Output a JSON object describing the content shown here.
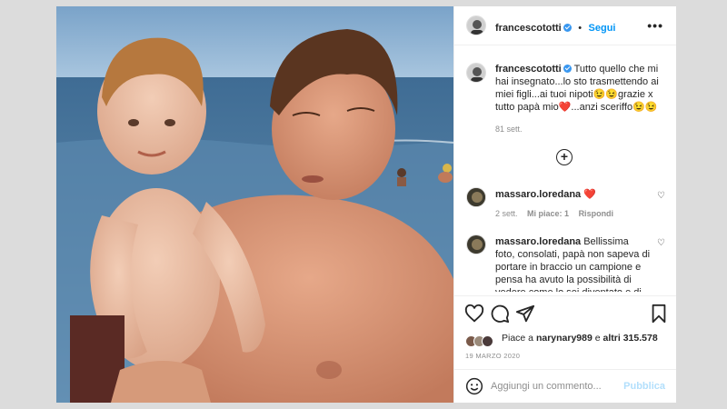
{
  "post": {
    "username": "francescototti",
    "follow_label": "Segui",
    "more_label": "•••",
    "caption": "Tutto quello che mi hai insegnato...lo sto trasmettendo ai miei figli...ai tuoi nipoti😉😉grazie x tutto papà mio❤️...anzi sceriffo😉😉",
    "caption_age": "81 sett.",
    "load_more_label": "+"
  },
  "comments": [
    {
      "username": "massaro.loredana",
      "text": "❤️",
      "age": "2 sett.",
      "likes": "Mi piace: 1",
      "reply": "Rispondi"
    },
    {
      "username": "massaro.loredana",
      "text": "Bellissima foto, consolati, papà non sapeva di portare in braccio un campione e pensa ha avuto la possibilità di vedere come lo sei diventato e di"
    }
  ],
  "likes": {
    "prefix": "Piace a ",
    "user": "narynary989",
    "middle": " e ",
    "others": "altri 315.578"
  },
  "date": "19 MARZO 2020",
  "add_comment": {
    "placeholder": "Aggiungi un commento...",
    "publish_label": "Pubblica"
  },
  "colors": {
    "accent": "#0095f6",
    "publish_disabled": "#b2dffc",
    "meta": "#8e8e8e",
    "heart": "#ed4956"
  },
  "icons": {
    "like": "heart-icon",
    "comment": "comment-icon",
    "share": "share-icon",
    "save": "bookmark-icon",
    "emoji": "emoji-icon",
    "more": "more-icon",
    "load_more": "plus-circle-icon"
  }
}
